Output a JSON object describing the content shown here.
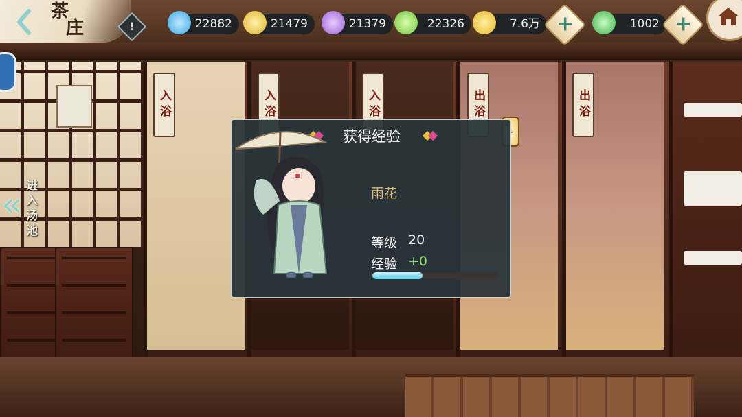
{
  "header": {
    "scene_title": [
      "茶",
      "庄"
    ],
    "back_icon": "chevron-left-icon",
    "info_icon": "exclamation-icon",
    "info_glyph": "!",
    "home_icon": "house-icon"
  },
  "resources": [
    {
      "id": "water-jade",
      "icon": "blue-gem-icon",
      "value": "22882",
      "color": "#3aa6e6"
    },
    {
      "id": "gold-jade",
      "icon": "yellow-gem-icon",
      "value": "21479",
      "color": "#e0b32a"
    },
    {
      "id": "purple-jade",
      "icon": "purple-gem-icon",
      "value": "21379",
      "color": "#9b5fd6"
    },
    {
      "id": "green-jade",
      "icon": "green-gem-icon",
      "value": "22326",
      "color": "#6fc23a"
    },
    {
      "id": "coins",
      "icon": "coin-icon",
      "value": "7.6万",
      "color": "#e6b52a"
    },
    {
      "id": "jade-currency",
      "icon": "jade-icon",
      "value": "1002",
      "color": "#3fae4a"
    }
  ],
  "plus_glyph": "+",
  "signs": [
    "入浴",
    "入浴",
    "入浴",
    "出浴",
    "出浴"
  ],
  "lantern_glyph": "♨",
  "side_nav": {
    "enter_pool_label": "进入汤池",
    "arrow_glyph": "«"
  },
  "dialog": {
    "title": "获得经验",
    "character_name": "雨花",
    "level_label": "等级",
    "level_value": "20",
    "exp_label": "经验",
    "exp_gain": "+0",
    "exp_progress": 0.4
  }
}
